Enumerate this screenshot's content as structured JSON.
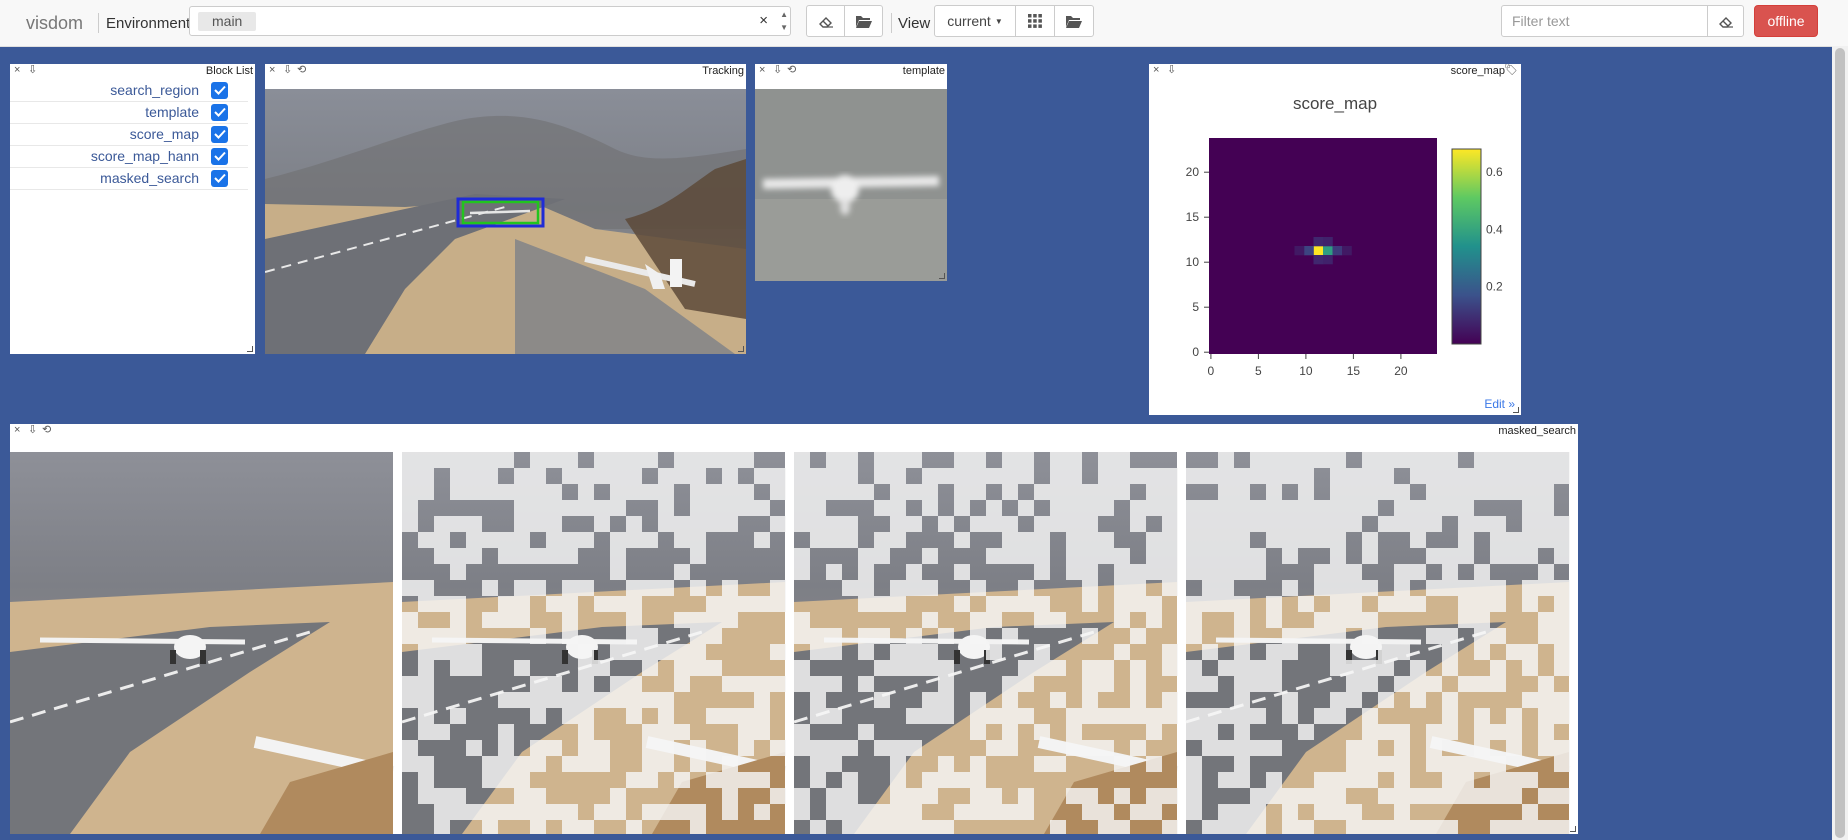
{
  "navbar": {
    "brand": "visdom",
    "environment_label": "Environment",
    "environment_value": "main",
    "clear_symbol": "×",
    "view_label": "View",
    "view_value": "current",
    "filter_placeholder": "Filter text",
    "status": "offline"
  },
  "panes": {
    "block_list": {
      "title": "Block List",
      "items": [
        {
          "label": "search_region",
          "checked": true
        },
        {
          "label": "template",
          "checked": true
        },
        {
          "label": "score_map",
          "checked": true
        },
        {
          "label": "score_map_hann",
          "checked": true
        },
        {
          "label": "masked_search",
          "checked": true
        }
      ]
    },
    "tracking": {
      "title": "Tracking"
    },
    "template": {
      "title": "template"
    },
    "score_map": {
      "title": "score_map",
      "edit_link": "Edit »"
    },
    "masked_search": {
      "title": "masked_search",
      "image_count": 4
    }
  },
  "chart_data": {
    "type": "heatmap",
    "title": "score_map",
    "xlabel": "",
    "ylabel": "",
    "grid_size": [
      24,
      24
    ],
    "xlim": [
      0,
      23
    ],
    "ylim": [
      0,
      23
    ],
    "x_ticks": [
      0,
      5,
      10,
      15,
      20
    ],
    "y_ticks": [
      0,
      5,
      10,
      15,
      20
    ],
    "colorbar_ticks": [
      0.2,
      0.4,
      0.6
    ],
    "colorscale": "viridis",
    "zmin": 0,
    "zmax": 0.68,
    "peak": {
      "x": 11,
      "y": 11,
      "value": 0.68
    },
    "nonzero_cells": [
      {
        "x": 11,
        "y": 11,
        "value": 0.68
      },
      {
        "x": 12,
        "y": 11,
        "value": 0.38
      },
      {
        "x": 10,
        "y": 11,
        "value": 0.14
      },
      {
        "x": 13,
        "y": 11,
        "value": 0.12
      },
      {
        "x": 11,
        "y": 12,
        "value": 0.08
      },
      {
        "x": 12,
        "y": 12,
        "value": 0.07
      },
      {
        "x": 11,
        "y": 10,
        "value": 0.08
      },
      {
        "x": 12,
        "y": 10,
        "value": 0.07
      },
      {
        "x": 9,
        "y": 11,
        "value": 0.05
      },
      {
        "x": 14,
        "y": 11,
        "value": 0.05
      }
    ]
  },
  "colors": {
    "background": "#3b5998",
    "offline_button": "#d9534f",
    "checkbox": "#1a73e8",
    "bbox_outer": "#1f2bd6",
    "bbox_inner": "#22c41e"
  }
}
